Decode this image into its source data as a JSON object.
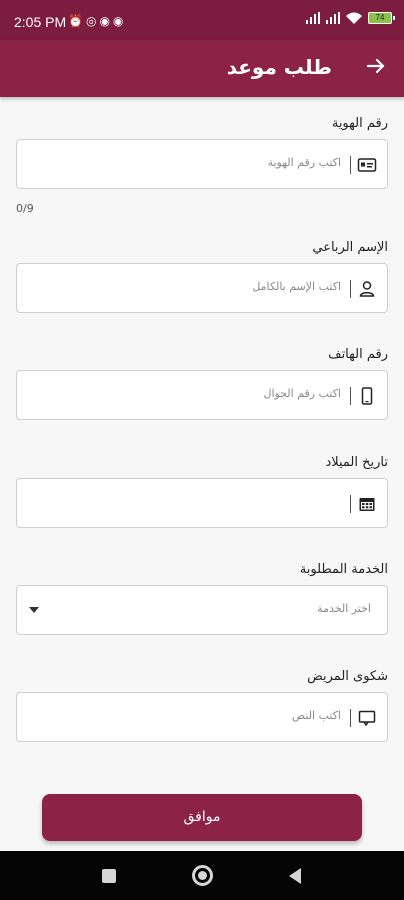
{
  "status_bar": {
    "time": "2:05 PM",
    "battery": "74",
    "left_icons": [
      "alarm-icon",
      "whatsapp-icon",
      "messenger-icon",
      "messenger-icon"
    ],
    "right_icons": [
      "signal-icon",
      "signal-icon",
      "wifi-icon",
      "battery-icon"
    ]
  },
  "app_bar": {
    "title": "طلب موعد",
    "back_icon": "arrow-right-icon",
    "color": "#8c2245"
  },
  "form": {
    "id_number": {
      "label": "رقم الهوية",
      "placeholder": "اكتب رقم الهوية",
      "icon": "id-card-icon",
      "counter": "0/9"
    },
    "full_name": {
      "label": "الإسم الرباعي",
      "placeholder": "اكتب الإسم بالكامل",
      "icon": "person-icon"
    },
    "phone": {
      "label": "رقم الهاتف",
      "placeholder": "اكتب رقم الجوال",
      "icon": "mobile-phone-icon"
    },
    "birth_date": {
      "label": "تاريخ الميلاد",
      "placeholder": "",
      "icon": "calendar-icon"
    },
    "service": {
      "label": "الخدمة المطلوبة",
      "placeholder": "اختر الخدمة",
      "icon": "dropdown-arrow-icon"
    },
    "complaint": {
      "label": "شكوى المريض",
      "placeholder": "اكتب النص",
      "icon": "message-icon"
    }
  },
  "submit_button": {
    "label": "موافق"
  },
  "nav_bar": {
    "icons": [
      "recents-icon",
      "home-icon",
      "back-icon"
    ]
  }
}
